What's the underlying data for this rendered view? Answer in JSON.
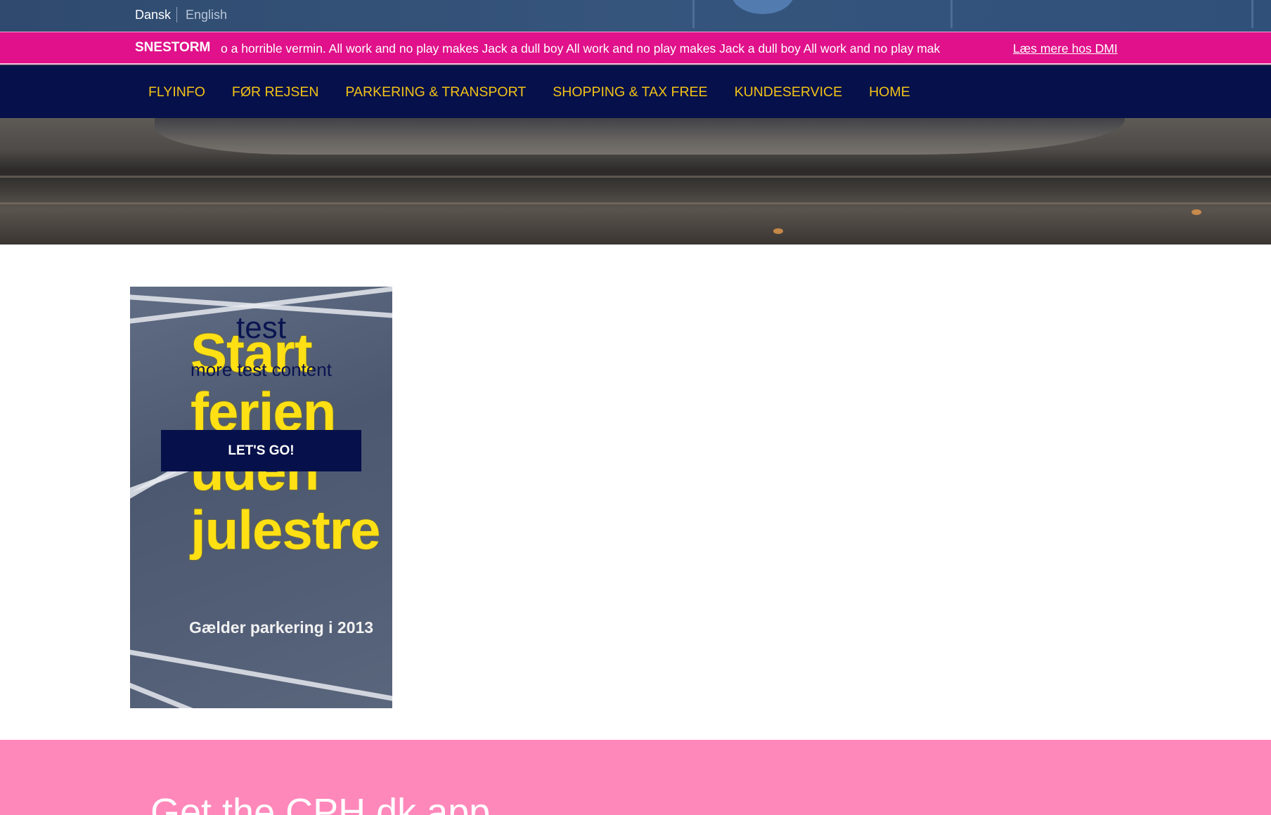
{
  "language": {
    "options": [
      "Dansk",
      "English"
    ],
    "active": "Dansk"
  },
  "alert": {
    "title": "SNESTORM",
    "ticker": "o a horrible vermin. All work and no play makes Jack a dull boy All work and no play makes Jack a dull boy All work and no play mak",
    "link_label": "Læs mere hos DMI"
  },
  "nav": {
    "items": [
      "FLYINFO",
      "FØR REJSEN",
      "PARKERING & TRANSPORT",
      "SHOPPING & TAX FREE",
      "KUNDESERVICE",
      "HOME"
    ]
  },
  "promo_card": {
    "title": "test",
    "text": "more test content",
    "button_label": "LET'S GO!",
    "image_lines": [
      "Start",
      "ferien",
      "uden",
      "julestre"
    ],
    "image_caption": "Gælder parkering i 2013"
  },
  "app_band": {
    "title": "Get the CPH.dk app"
  },
  "colors": {
    "alert_bg": "#e0118a",
    "nav_bg": "#06104a",
    "nav_text": "#f2c318",
    "app_band_bg": "#ff88bb"
  }
}
